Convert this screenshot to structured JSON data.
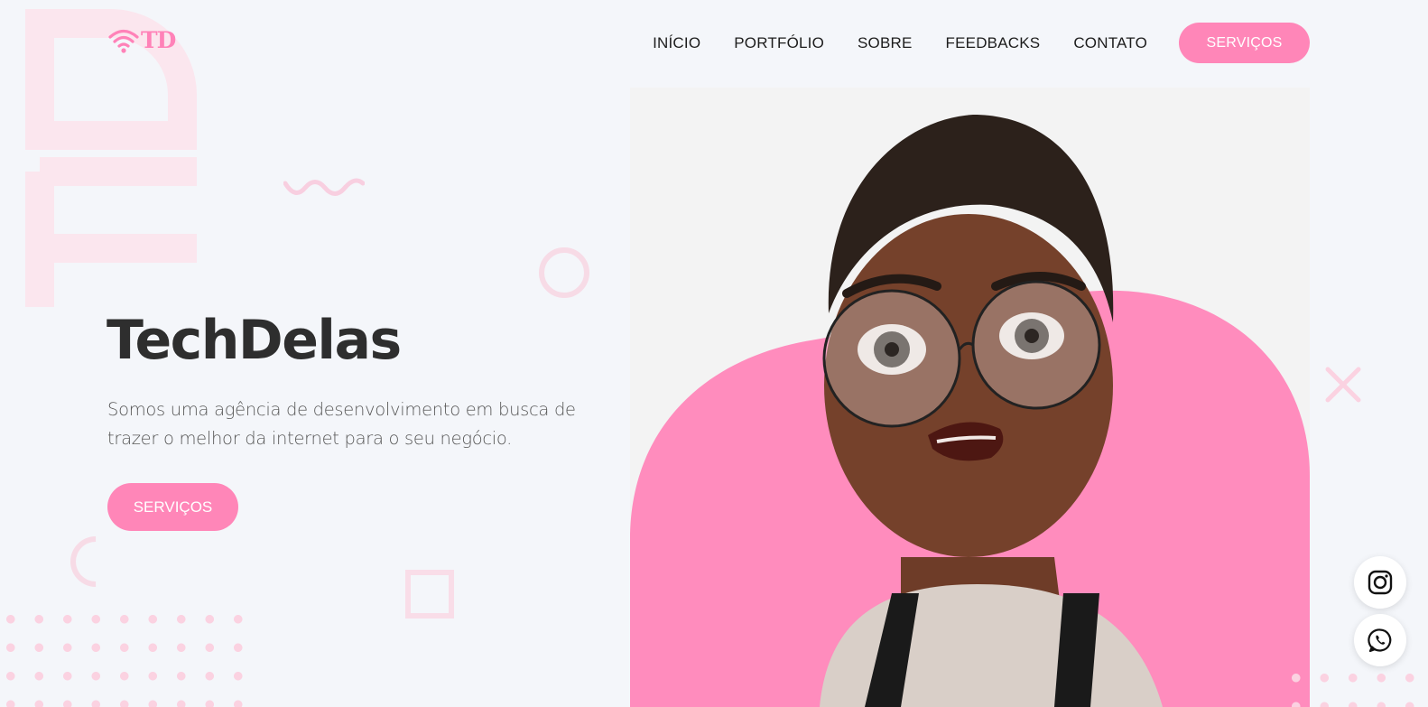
{
  "brand": {
    "logo_text": "TD",
    "name": "TechDelas",
    "accent_color": "#ff86b8"
  },
  "nav": {
    "items": [
      {
        "label": "INÍCIO"
      },
      {
        "label": "PORTFÓLIO"
      },
      {
        "label": "SOBRE"
      },
      {
        "label": "FEEDBACKS"
      },
      {
        "label": "CONTATO"
      }
    ],
    "cta_label": "SERVIÇOS"
  },
  "hero": {
    "title": "TechDelas",
    "description": "Somos uma agência de desenvolvimento em busca de trazer o melhor da internet para o seu negócio.",
    "button_label": "SERVIÇOS",
    "image_alt": "avatar-illustration"
  },
  "social": {
    "items": [
      {
        "icon": "instagram-icon"
      },
      {
        "icon": "whatsapp-icon"
      }
    ]
  }
}
